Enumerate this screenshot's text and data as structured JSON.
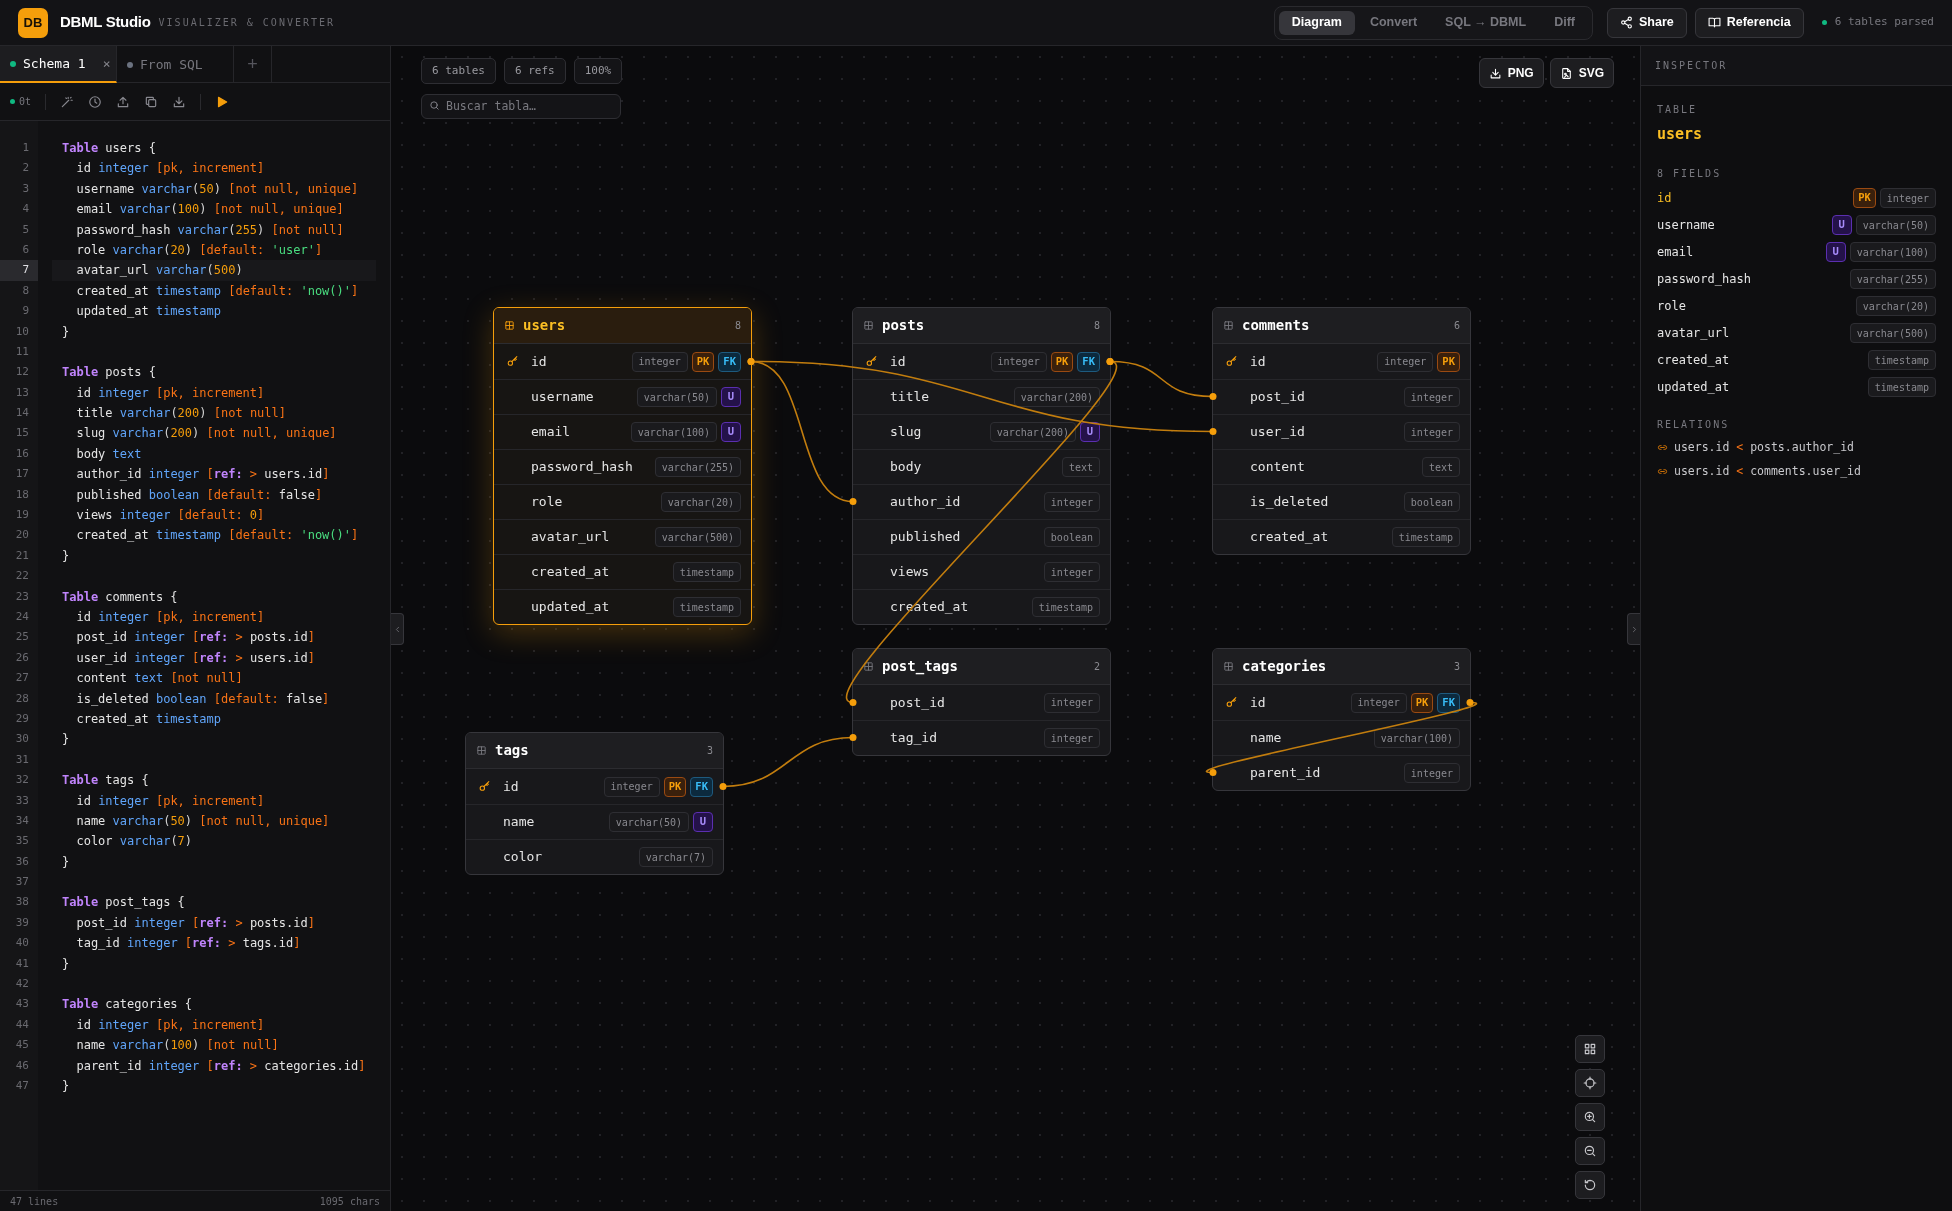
{
  "header": {
    "logo": "DB",
    "title": "DBML Studio",
    "subtitle": "VISUALIZER & CONVERTER",
    "nav": [
      {
        "label": "Diagram",
        "selected": true
      },
      {
        "label": "Convert",
        "selected": false
      },
      {
        "label": "SQL → DBML",
        "selected": false
      },
      {
        "label": "Diff",
        "selected": false
      }
    ],
    "share": "Share",
    "reference": "Referencia",
    "status": "6 tables parsed"
  },
  "editor": {
    "tabs": [
      {
        "label": "Schema 1",
        "selected": true,
        "color": "#10b981",
        "close": "×"
      },
      {
        "label": "From SQL",
        "selected": false,
        "color": "#6b7280"
      }
    ],
    "add_tab": "+",
    "toolbar_status": "0t",
    "lines": [
      {
        "n": "1",
        "active": false,
        "tokens": [
          {
            "kind": "kw",
            "t": "Table"
          },
          {
            "kind": "id",
            "t": " users {"
          }
        ]
      },
      {
        "n": "2",
        "active": false,
        "tokens": [
          {
            "kind": "id",
            "t": "  id "
          },
          {
            "kind": "ty",
            "t": "integer"
          },
          {
            "kind": "at",
            "t": " [pk, increment]"
          }
        ]
      },
      {
        "n": "3",
        "active": false,
        "tokens": [
          {
            "kind": "id",
            "t": "  username "
          },
          {
            "kind": "ty",
            "t": "varchar"
          },
          {
            "kind": "p",
            "t": "("
          },
          {
            "kind": "num",
            "t": "50"
          },
          {
            "kind": "p",
            "t": ")"
          },
          {
            "kind": "at",
            "t": " [not null, unique]"
          }
        ]
      },
      {
        "n": "4",
        "active": false,
        "tokens": [
          {
            "kind": "id",
            "t": "  email "
          },
          {
            "kind": "ty",
            "t": "varchar"
          },
          {
            "kind": "p",
            "t": "("
          },
          {
            "kind": "num",
            "t": "100"
          },
          {
            "kind": "p",
            "t": ")"
          },
          {
            "kind": "at",
            "t": " [not null, unique]"
          }
        ]
      },
      {
        "n": "5",
        "active": false,
        "tokens": [
          {
            "kind": "id",
            "t": "  password_hash "
          },
          {
            "kind": "ty",
            "t": "varchar"
          },
          {
            "kind": "p",
            "t": "("
          },
          {
            "kind": "num",
            "t": "255"
          },
          {
            "kind": "p",
            "t": ")"
          },
          {
            "kind": "at",
            "t": " [not null]"
          }
        ]
      },
      {
        "n": "6",
        "active": false,
        "tokens": [
          {
            "kind": "id",
            "t": "  role "
          },
          {
            "kind": "ty",
            "t": "varchar"
          },
          {
            "kind": "p",
            "t": "("
          },
          {
            "kind": "num",
            "t": "20"
          },
          {
            "kind": "p",
            "t": ")"
          },
          {
            "kind": "at",
            "t": " [default: "
          },
          {
            "kind": "str",
            "t": "'user'"
          },
          {
            "kind": "at",
            "t": "]"
          }
        ]
      },
      {
        "n": "7",
        "active": true,
        "tokens": [
          {
            "kind": "id",
            "t": "  avatar_url "
          },
          {
            "kind": "ty",
            "t": "varchar"
          },
          {
            "kind": "p",
            "t": "("
          },
          {
            "kind": "num",
            "t": "500"
          },
          {
            "kind": "p",
            "t": ")"
          }
        ]
      },
      {
        "n": "8",
        "active": false,
        "tokens": [
          {
            "kind": "id",
            "t": "  created_at "
          },
          {
            "kind": "ty",
            "t": "timestamp"
          },
          {
            "kind": "at",
            "t": " [default: "
          },
          {
            "kind": "str",
            "t": "'now()'"
          },
          {
            "kind": "at",
            "t": "]"
          }
        ]
      },
      {
        "n": "9",
        "active": false,
        "tokens": [
          {
            "kind": "id",
            "t": "  updated_at "
          },
          {
            "kind": "ty",
            "t": "timestamp"
          }
        ]
      },
      {
        "n": "10",
        "active": false,
        "tokens": [
          {
            "kind": "id",
            "t": "}"
          }
        ]
      },
      {
        "n": "11",
        "active": false
      },
      {
        "n": "12",
        "active": false,
        "tokens": [
          {
            "kind": "kw",
            "t": "Table"
          },
          {
            "kind": "id",
            "t": " posts {"
          }
        ]
      },
      {
        "n": "13",
        "active": false,
        "tokens": [
          {
            "kind": "id",
            "t": "  id "
          },
          {
            "kind": "ty",
            "t": "integer"
          },
          {
            "kind": "at",
            "t": " [pk, increment]"
          }
        ]
      },
      {
        "n": "14",
        "active": false,
        "tokens": [
          {
            "kind": "id",
            "t": "  title "
          },
          {
            "kind": "ty",
            "t": "varchar"
          },
          {
            "kind": "p",
            "t": "("
          },
          {
            "kind": "num",
            "t": "200"
          },
          {
            "kind": "p",
            "t": ")"
          },
          {
            "kind": "at",
            "t": " [not null]"
          }
        ]
      },
      {
        "n": "15",
        "active": false,
        "tokens": [
          {
            "kind": "id",
            "t": "  slug "
          },
          {
            "kind": "ty",
            "t": "varchar"
          },
          {
            "kind": "p",
            "t": "("
          },
          {
            "kind": "num",
            "t": "200"
          },
          {
            "kind": "p",
            "t": ")"
          },
          {
            "kind": "at",
            "t": " [not null, unique]"
          }
        ]
      },
      {
        "n": "16",
        "active": false,
        "tokens": [
          {
            "kind": "id",
            "t": "  body "
          },
          {
            "kind": "ty",
            "t": "text"
          }
        ]
      },
      {
        "n": "17",
        "active": false,
        "tokens": [
          {
            "kind": "id",
            "t": "  author_id "
          },
          {
            "kind": "ty",
            "t": "integer"
          },
          {
            "kind": "at",
            "t": " ["
          },
          {
            "kind": "kw",
            "t": "ref:"
          },
          {
            "kind": "at",
            "t": " > "
          },
          {
            "kind": "id",
            "t": "users.id"
          },
          {
            "kind": "at",
            "t": "]"
          }
        ]
      },
      {
        "n": "18",
        "active": false,
        "tokens": [
          {
            "kind": "id",
            "t": "  published "
          },
          {
            "kind": "ty",
            "t": "boolean"
          },
          {
            "kind": "at",
            "t": " [default: "
          },
          {
            "kind": "id",
            "t": "false"
          },
          {
            "kind": "at",
            "t": "]"
          }
        ]
      },
      {
        "n": "19",
        "active": false,
        "tokens": [
          {
            "kind": "id",
            "t": "  views "
          },
          {
            "kind": "ty",
            "t": "integer"
          },
          {
            "kind": "at",
            "t": " [default: "
          },
          {
            "kind": "num",
            "t": "0"
          },
          {
            "kind": "at",
            "t": "]"
          }
        ]
      },
      {
        "n": "20",
        "active": false,
        "tokens": [
          {
            "kind": "id",
            "t": "  created_at "
          },
          {
            "kind": "ty",
            "t": "timestamp"
          },
          {
            "kind": "at",
            "t": " [default: "
          },
          {
            "kind": "str",
            "t": "'now()'"
          },
          {
            "kind": "at",
            "t": "]"
          }
        ]
      },
      {
        "n": "21",
        "active": false,
        "tokens": [
          {
            "kind": "id",
            "t": "}"
          }
        ]
      },
      {
        "n": "22",
        "active": false
      },
      {
        "n": "23",
        "active": false,
        "tokens": [
          {
            "kind": "kw",
            "t": "Table"
          },
          {
            "kind": "id",
            "t": " comments {"
          }
        ]
      },
      {
        "n": "24",
        "active": false,
        "tokens": [
          {
            "kind": "id",
            "t": "  id "
          },
          {
            "kind": "ty",
            "t": "integer"
          },
          {
            "kind": "at",
            "t": " [pk, increment]"
          }
        ]
      },
      {
        "n": "25",
        "active": false,
        "tokens": [
          {
            "kind": "id",
            "t": "  post_id "
          },
          {
            "kind": "ty",
            "t": "integer"
          },
          {
            "kind": "at",
            "t": " ["
          },
          {
            "kind": "kw",
            "t": "ref:"
          },
          {
            "kind": "at",
            "t": " > "
          },
          {
            "kind": "id",
            "t": "posts.id"
          },
          {
            "kind": "at",
            "t": "]"
          }
        ]
      },
      {
        "n": "26",
        "active": false,
        "tokens": [
          {
            "kind": "id",
            "t": "  user_id "
          },
          {
            "kind": "ty",
            "t": "integer"
          },
          {
            "kind": "at",
            "t": " ["
          },
          {
            "kind": "kw",
            "t": "ref:"
          },
          {
            "kind": "at",
            "t": " > "
          },
          {
            "kind": "id",
            "t": "users.id"
          },
          {
            "kind": "at",
            "t": "]"
          }
        ]
      },
      {
        "n": "27",
        "active": false,
        "tokens": [
          {
            "kind": "id",
            "t": "  content "
          },
          {
            "kind": "ty",
            "t": "text"
          },
          {
            "kind": "at",
            "t": " [not null]"
          }
        ]
      },
      {
        "n": "28",
        "active": false,
        "tokens": [
          {
            "kind": "id",
            "t": "  is_deleted "
          },
          {
            "kind": "ty",
            "t": "boolean"
          },
          {
            "kind": "at",
            "t": " [default: "
          },
          {
            "kind": "id",
            "t": "false"
          },
          {
            "kind": "at",
            "t": "]"
          }
        ]
      },
      {
        "n": "29",
        "active": false,
        "tokens": [
          {
            "kind": "id",
            "t": "  created_at "
          },
          {
            "kind": "ty",
            "t": "timestamp"
          }
        ]
      },
      {
        "n": "30",
        "active": false,
        "tokens": [
          {
            "kind": "id",
            "t": "}"
          }
        ]
      },
      {
        "n": "31",
        "active": false
      },
      {
        "n": "32",
        "active": false,
        "tokens": [
          {
            "kind": "kw",
            "t": "Table"
          },
          {
            "kind": "id",
            "t": " tags {"
          }
        ]
      },
      {
        "n": "33",
        "active": false,
        "tokens": [
          {
            "kind": "id",
            "t": "  id "
          },
          {
            "kind": "ty",
            "t": "integer"
          },
          {
            "kind": "at",
            "t": " [pk, increment]"
          }
        ]
      },
      {
        "n": "34",
        "active": false,
        "tokens": [
          {
            "kind": "id",
            "t": "  name "
          },
          {
            "kind": "ty",
            "t": "varchar"
          },
          {
            "kind": "p",
            "t": "("
          },
          {
            "kind": "num",
            "t": "50"
          },
          {
            "kind": "p",
            "t": ")"
          },
          {
            "kind": "at",
            "t": " [not null, unique]"
          }
        ]
      },
      {
        "n": "35",
        "active": false,
        "tokens": [
          {
            "kind": "id",
            "t": "  color "
          },
          {
            "kind": "ty",
            "t": "varchar"
          },
          {
            "kind": "p",
            "t": "("
          },
          {
            "kind": "num",
            "t": "7"
          },
          {
            "kind": "p",
            "t": ")"
          }
        ]
      },
      {
        "n": "36",
        "active": false,
        "tokens": [
          {
            "kind": "id",
            "t": "}"
          }
        ]
      },
      {
        "n": "37",
        "active": false
      },
      {
        "n": "38",
        "active": false,
        "tokens": [
          {
            "kind": "kw",
            "t": "Table"
          },
          {
            "kind": "id",
            "t": " post_tags {"
          }
        ]
      },
      {
        "n": "39",
        "active": false,
        "tokens": [
          {
            "kind": "id",
            "t": "  post_id "
          },
          {
            "kind": "ty",
            "t": "integer"
          },
          {
            "kind": "at",
            "t": " ["
          },
          {
            "kind": "kw",
            "t": "ref:"
          },
          {
            "kind": "at",
            "t": " > "
          },
          {
            "kind": "id",
            "t": "posts.id"
          },
          {
            "kind": "at",
            "t": "]"
          }
        ]
      },
      {
        "n": "40",
        "active": false,
        "tokens": [
          {
            "kind": "id",
            "t": "  tag_id "
          },
          {
            "kind": "ty",
            "t": "integer"
          },
          {
            "kind": "at",
            "t": " ["
          },
          {
            "kind": "kw",
            "t": "ref:"
          },
          {
            "kind": "at",
            "t": " > "
          },
          {
            "kind": "id",
            "t": "tags.id"
          },
          {
            "kind": "at",
            "t": "]"
          }
        ]
      },
      {
        "n": "41",
        "active": false,
        "tokens": [
          {
            "kind": "id",
            "t": "}"
          }
        ]
      },
      {
        "n": "42",
        "active": false
      },
      {
        "n": "43",
        "active": false,
        "tokens": [
          {
            "kind": "kw",
            "t": "Table"
          },
          {
            "kind": "id",
            "t": " categories {"
          }
        ]
      },
      {
        "n": "44",
        "active": false,
        "tokens": [
          {
            "kind": "id",
            "t": "  id "
          },
          {
            "kind": "ty",
            "t": "integer"
          },
          {
            "kind": "at",
            "t": " [pk, increment]"
          }
        ]
      },
      {
        "n": "45",
        "active": false,
        "tokens": [
          {
            "kind": "id",
            "t": "  name "
          },
          {
            "kind": "ty",
            "t": "varchar"
          },
          {
            "kind": "p",
            "t": "("
          },
          {
            "kind": "num",
            "t": "100"
          },
          {
            "kind": "p",
            "t": ")"
          },
          {
            "kind": "at",
            "t": " [not null]"
          }
        ]
      },
      {
        "n": "46",
        "active": false,
        "tokens": [
          {
            "kind": "id",
            "t": "  parent_id "
          },
          {
            "kind": "ty",
            "t": "integer"
          },
          {
            "kind": "at",
            "t": " ["
          },
          {
            "kind": "kw",
            "t": "ref:"
          },
          {
            "kind": "at",
            "t": " > "
          },
          {
            "kind": "id",
            "t": "categories.id"
          },
          {
            "kind": "at",
            "t": "]"
          }
        ]
      },
      {
        "n": "47",
        "active": false,
        "tokens": [
          {
            "kind": "id",
            "t": "}"
          }
        ]
      }
    ],
    "footer_lines": "47 lines",
    "footer_chars": "1095 chars"
  },
  "diagram": {
    "chips": [
      "6 tables",
      "6 refs",
      "100%"
    ],
    "search": {
      "placeholder": "Buscar tabla…"
    },
    "export": [
      "PNG",
      "SVG"
    ],
    "tables": [
      {
        "name": "users",
        "count": "8",
        "selected": true,
        "fields": [
          {
            "name": "id",
            "type": "integer",
            "badges": [
              {
                "kind": "pk",
                "text": "PK"
              },
              {
                "kind": "fk",
                "text": "FK"
              }
            ]
          },
          {
            "name": "username",
            "type": "varchar(50)",
            "badges": [
              {
                "kind": "unique",
                "text": "U"
              }
            ]
          },
          {
            "name": "email",
            "type": "varchar(100)",
            "badges": [
              {
                "kind": "unique",
                "text": "U"
              }
            ]
          },
          {
            "name": "password_hash",
            "type": "varchar(255)"
          },
          {
            "name": "role",
            "type": "varchar(20)"
          },
          {
            "name": "avatar_url",
            "type": "varchar(500)"
          },
          {
            "name": "created_at",
            "type": "timestamp"
          },
          {
            "name": "updated_at",
            "type": "timestamp"
          }
        ]
      },
      {
        "name": "posts",
        "count": "8",
        "selected": false,
        "fields": [
          {
            "name": "id",
            "type": "integer",
            "badges": [
              {
                "kind": "pk",
                "text": "PK"
              },
              {
                "kind": "fk",
                "text": "FK"
              }
            ]
          },
          {
            "name": "title",
            "type": "varchar(200)"
          },
          {
            "name": "slug",
            "type": "varchar(200)",
            "badges": [
              {
                "kind": "unique",
                "text": "U"
              }
            ]
          },
          {
            "name": "body",
            "type": "text"
          },
          {
            "name": "author_id",
            "type": "integer"
          },
          {
            "name": "published",
            "type": "boolean"
          },
          {
            "name": "views",
            "type": "integer"
          },
          {
            "name": "created_at",
            "type": "timestamp"
          }
        ]
      },
      {
        "name": "comments",
        "count": "6",
        "selected": false,
        "fields": [
          {
            "name": "id",
            "type": "integer",
            "badges": [
              {
                "kind": "pk",
                "text": "PK"
              }
            ]
          },
          {
            "name": "post_id",
            "type": "integer"
          },
          {
            "name": "user_id",
            "type": "integer"
          },
          {
            "name": "content",
            "type": "text"
          },
          {
            "name": "is_deleted",
            "type": "boolean"
          },
          {
            "name": "created_at",
            "type": "timestamp"
          }
        ]
      },
      {
        "name": "post_tags",
        "count": "2",
        "selected": false,
        "fields": [
          {
            "name": "post_id",
            "type": "integer"
          },
          {
            "name": "tag_id",
            "type": "integer"
          }
        ]
      },
      {
        "name": "categories",
        "count": "3",
        "selected": false,
        "fields": [
          {
            "name": "id",
            "type": "integer",
            "badges": [
              {
                "kind": "pk",
                "text": "PK"
              },
              {
                "kind": "fk",
                "text": "FK"
              }
            ]
          },
          {
            "name": "name",
            "type": "varchar(100)"
          },
          {
            "name": "parent_id",
            "type": "integer"
          }
        ]
      },
      {
        "name": "tags",
        "count": "3",
        "selected": false,
        "fields": [
          {
            "name": "id",
            "type": "integer",
            "badges": [
              {
                "kind": "pk",
                "text": "PK"
              },
              {
                "kind": "fk",
                "text": "FK"
              }
            ]
          },
          {
            "name": "name",
            "type": "varchar(50)",
            "badges": [
              {
                "kind": "unique",
                "text": "U"
              }
            ]
          },
          {
            "name": "color",
            "type": "varchar(7)"
          }
        ]
      }
    ]
  },
  "inspector": {
    "title": "INSPECTOR",
    "table_label": "TABLE",
    "table_name": "users",
    "fields_label": "8 FIELDS",
    "fields": [
      {
        "name": "id",
        "type": "integer",
        "badges": [
          {
            "kind": "pk",
            "text": "PK"
          }
        ]
      },
      {
        "name": "username",
        "type": "varchar(50)",
        "badges": [
          {
            "kind": "unique",
            "text": "U"
          }
        ]
      },
      {
        "name": "email",
        "type": "varchar(100)",
        "badges": [
          {
            "kind": "unique",
            "text": "U"
          }
        ]
      },
      {
        "name": "password_hash",
        "type": "varchar(255)"
      },
      {
        "name": "role",
        "type": "varchar(20)"
      },
      {
        "name": "avatar_url",
        "type": "varchar(500)"
      },
      {
        "name": "created_at",
        "type": "timestamp"
      },
      {
        "name": "updated_at",
        "type": "timestamp"
      }
    ],
    "relations_label": "RELATIONS",
    "relations": [
      {
        "from": "users.id",
        "op": "<",
        "to": "posts.author_id"
      },
      {
        "from": "users.id",
        "op": "<",
        "to": "comments.user_id"
      }
    ]
  }
}
